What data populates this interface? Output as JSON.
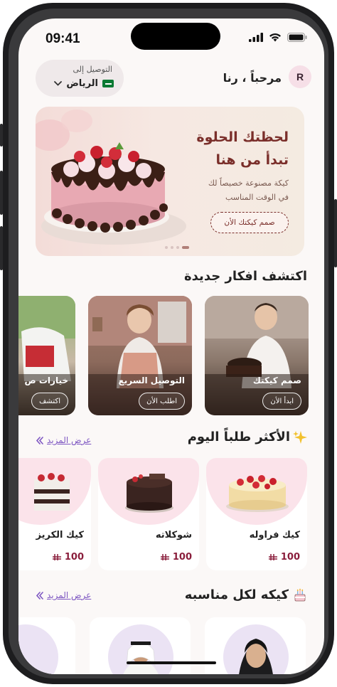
{
  "status": {
    "time": "09:41"
  },
  "header": {
    "deliver_label": "التوصيل إلى",
    "city": "الرياض",
    "greeting": "مرحباً ، رنا",
    "avatar_initial": "R"
  },
  "hero": {
    "title_line1": "لحظتك الحلوة",
    "title_line2": "تبدأ من هنا",
    "subtitle_line1": "كيكة مصنوعة خصيصاً لك",
    "subtitle_line2": "في الوقت المناسب",
    "cta": "صمم كيكتك الأن"
  },
  "ideas": {
    "title": "اكتشف افكار جديدة",
    "cards": [
      {
        "label": "صمم كيكتك",
        "button": "ابدأ الأن"
      },
      {
        "label": "التوصيل السريع",
        "button": "اطلب الأن"
      },
      {
        "label": "خيارات ص",
        "button": "اكتشف"
      }
    ]
  },
  "popular": {
    "title": "الأكثر طلباً اليوم",
    "more": "عرض المزيد",
    "products": [
      {
        "name": "كيك فراوله",
        "price": "100"
      },
      {
        "name": "شوكلاته",
        "price": "100"
      },
      {
        "name": "كيك الكريز",
        "price": "100"
      }
    ]
  },
  "occasions": {
    "title": "كيكه لكل مناسبه",
    "more": "عرض المزيد"
  },
  "colors": {
    "accent": "#7a2e2a",
    "price": "#8a1e3c",
    "link": "#7e57c2",
    "card_pink": "#fbe3ea"
  },
  "icons": [
    "chevron-down-icon",
    "saudi-flag-icon",
    "sparkle-icon",
    "cake-icon",
    "riyal-icon",
    "double-chevron-icon",
    "signal-icon",
    "wifi-icon",
    "battery-icon"
  ]
}
